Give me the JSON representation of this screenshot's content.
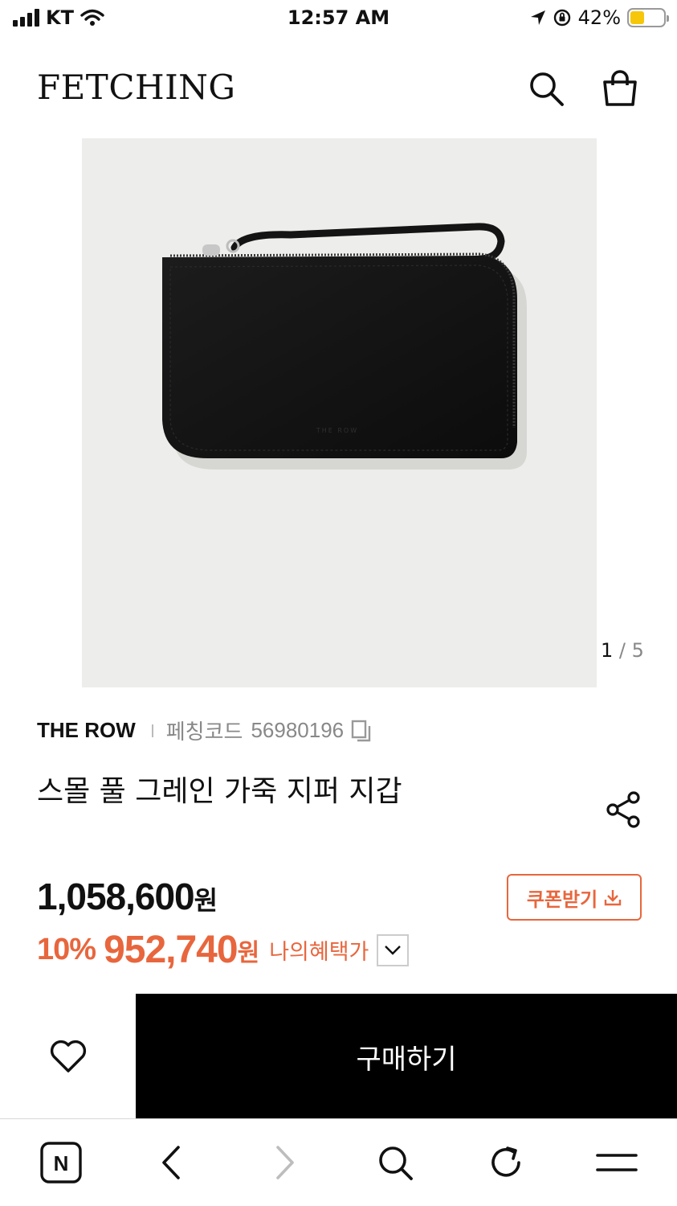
{
  "status_bar": {
    "carrier": "KT",
    "time": "12:57 AM",
    "battery_pct": "42%",
    "battery_level": 0.42,
    "battery_color": "#f6c60b"
  },
  "header": {
    "logo": "FETCHING"
  },
  "gallery": {
    "current": "1",
    "separator": " / ",
    "total": "5"
  },
  "product": {
    "brand": "THE ROW",
    "code_label": "페칭코드",
    "code_value": "56980196",
    "title": "스몰 풀 그레인 가죽 지퍼 지갑",
    "image_imprint": "THE ROW"
  },
  "pricing": {
    "original_price": "1,058,600",
    "currency_unit": "원",
    "coupon_label": "쿠폰받기",
    "discount_pct": "10%",
    "discount_price": "952,740",
    "benefit_label": "나의혜택가",
    "accent_color": "#e8663d"
  },
  "purchase": {
    "buy_label": "구매하기"
  },
  "browser_toolbar": {
    "home_glyph": "N"
  }
}
